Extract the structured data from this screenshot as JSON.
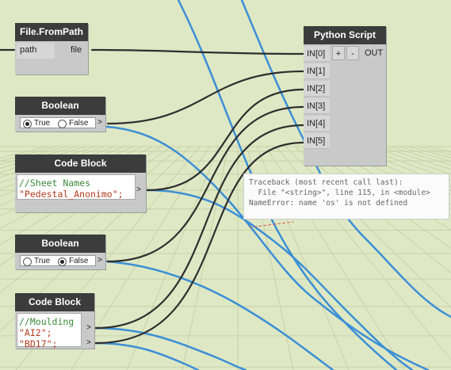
{
  "colors": {
    "canvas": "#dfe8c4",
    "node_header": "#3c3c3c",
    "node_body": "#c9c9c9",
    "wire_dark": "#2e2e2e",
    "wire_blue": "#3b8fd6",
    "grid": "#c7d2a9"
  },
  "nodes": {
    "file_from_path": {
      "title": "File.FromPath",
      "input": "path",
      "output": "file"
    },
    "boolean_1": {
      "title": "Boolean",
      "option_true": "True",
      "option_false": "False",
      "selected": "True",
      "output_arrow": ">"
    },
    "code_block_1": {
      "title": "Code Block",
      "comment": "//Sheet Names",
      "line": "\"Pedestal_Anonimo\";",
      "output_arrow": ">"
    },
    "boolean_2": {
      "title": "Boolean",
      "option_true": "True",
      "option_false": "False",
      "selected": "False",
      "output_arrow": ">"
    },
    "code_block_2": {
      "title": "Code Block",
      "comment": "//Moulding",
      "line1": "\"AI2\";",
      "line2": "\"BD17\";",
      "output_arrow": ">"
    },
    "python_script": {
      "title": "Python Script",
      "inputs": [
        "IN[0]",
        "IN[1]",
        "IN[2]",
        "IN[3]",
        "IN[4]",
        "IN[5]"
      ],
      "add_label": "+",
      "remove_label": "-",
      "output": "OUT"
    }
  },
  "error": {
    "line1": "Traceback (most recent call last):",
    "line2": "  File \"<string>\", line 115, in <module>",
    "line3": "NameError: name 'os' is not defined"
  }
}
